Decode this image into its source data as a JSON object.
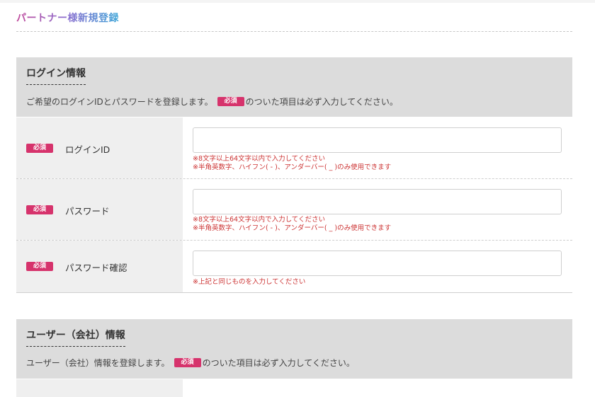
{
  "header": {
    "title": "パートナー様新規登録"
  },
  "badge_label": "必須",
  "login_section": {
    "title": "ログイン情報",
    "desc_before": "ご希望のログインIDとパスワードを登録します。",
    "desc_after": "のついた項目は必ず入力してください。",
    "fields": [
      {
        "label": "ログインID",
        "value": "",
        "placeholder": "",
        "hints": [
          "※8文字以上64文字以内で入力してください",
          "※半角英数字、ハイフン( - )、アンダーバー( _ )のみ使用できます"
        ]
      },
      {
        "label": "パスワード",
        "value": "",
        "placeholder": "",
        "hints": [
          "※8文字以上64文字以内で入力してください",
          "※半角英数字、ハイフン( - )、アンダーバー( _ )のみ使用できます"
        ]
      },
      {
        "label": "パスワード確認",
        "value": "",
        "placeholder": "",
        "hints": [
          "※上記と同じものを入力してください"
        ]
      }
    ]
  },
  "user_section": {
    "title": "ユーザー（会社）情報",
    "desc_before": "ユーザー（会社）情報を登録します。",
    "desc_after": "のついた項目は必ず入力してください。"
  },
  "colors": {
    "badge": "#d6336c",
    "hint": "#cc3333",
    "section_bg": "#dcdcdc",
    "label_bg": "#efefef"
  }
}
